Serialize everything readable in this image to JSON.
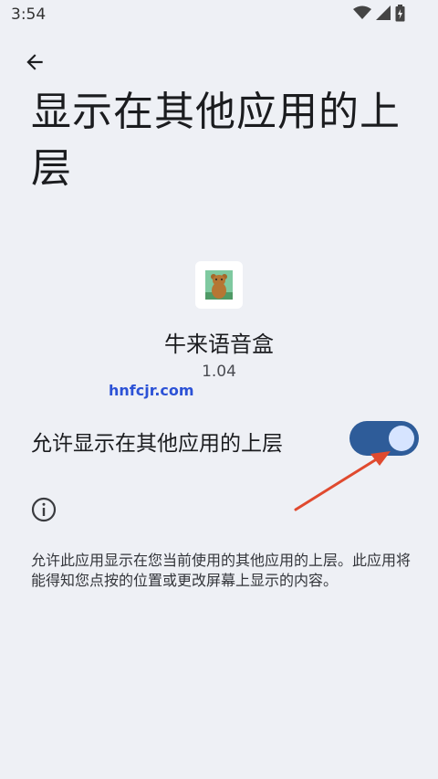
{
  "status_bar": {
    "time": "3:54",
    "icons": [
      "wifi-icon",
      "signal-icon",
      "battery-icon"
    ]
  },
  "header": {
    "title": "显示在其他应用的上层",
    "back_icon": "back-arrow-icon"
  },
  "app": {
    "name": "牛来语音盒",
    "version": "1.04",
    "icon": "bear-app-icon"
  },
  "watermark": "hnfcjr.com",
  "permission": {
    "label": "允许显示在其他应用的上层",
    "enabled": true
  },
  "info": {
    "icon": "info-icon",
    "description": "允许此应用显示在您当前使用的其他应用的上层。此应用将能得知您点按的位置或更改屏幕上显示的内容。"
  },
  "colors": {
    "background": "#eef0f5",
    "toggle_track": "#2e5c99",
    "toggle_knob": "#d6e4ff",
    "annotation_arrow": "#e04a2f",
    "watermark": "#2c52d6"
  }
}
